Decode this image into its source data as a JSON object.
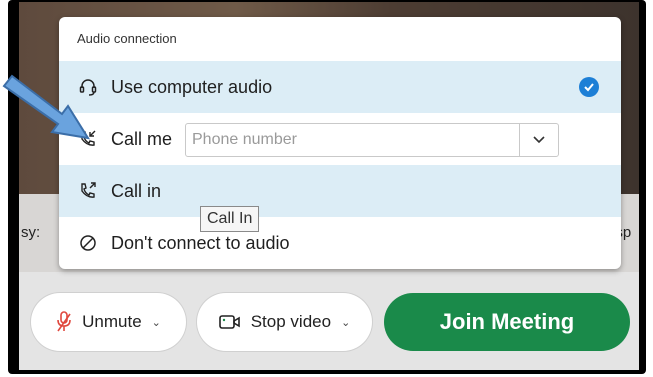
{
  "dialog": {
    "title": "Audio connection",
    "options": [
      {
        "label": "Use computer audio",
        "icon": "headset-icon",
        "selected": true
      },
      {
        "label": "Call me",
        "icon": "phone-incoming-icon"
      },
      {
        "label": "Call in",
        "icon": "phone-outgoing-icon"
      },
      {
        "label": "Don't connect to audio",
        "icon": "no-audio-icon"
      }
    ],
    "phone": {
      "placeholder": "Phone number",
      "value": ""
    }
  },
  "tooltip": "Call In",
  "background": {
    "left_text": "sy:",
    "right_text": "t sp"
  },
  "toolbar": {
    "unmute_label": "Unmute",
    "video_label": "Stop video",
    "join_label": "Join Meeting"
  },
  "colors": {
    "join": "#1a8a4a",
    "selected_row": "#dcedf6",
    "check": "#1d7fd6",
    "muted_mic": "#e0483e"
  }
}
